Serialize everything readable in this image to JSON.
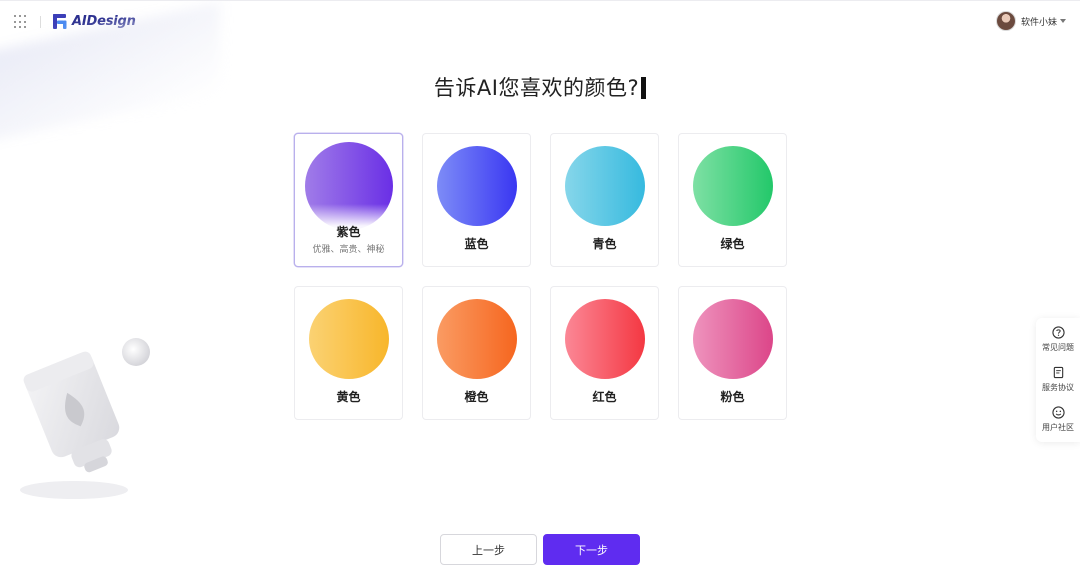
{
  "app": {
    "name": "AIDesign"
  },
  "user": {
    "name": "软件小妹"
  },
  "page": {
    "title": "告诉AI您喜欢的颜色?"
  },
  "colors": [
    {
      "label": "紫色",
      "desc": "优雅、高贵、神秘",
      "selected": true,
      "from": "#a07ce8",
      "to": "#6a2fe6"
    },
    {
      "label": "蓝色",
      "desc": "",
      "selected": false,
      "from": "#7d8cf7",
      "to": "#3a37f2"
    },
    {
      "label": "青色",
      "desc": "",
      "selected": false,
      "from": "#86d6ea",
      "to": "#36badf"
    },
    {
      "label": "绿色",
      "desc": "",
      "selected": false,
      "from": "#7ee0a4",
      "to": "#23c86a"
    },
    {
      "label": "黄色",
      "desc": "",
      "selected": false,
      "from": "#fbd273",
      "to": "#f8b62b"
    },
    {
      "label": "橙色",
      "desc": "",
      "selected": false,
      "from": "#fa9b63",
      "to": "#f6661f"
    },
    {
      "label": "红色",
      "desc": "",
      "selected": false,
      "from": "#fb8796",
      "to": "#f43842"
    },
    {
      "label": "粉色",
      "desc": "",
      "selected": false,
      "from": "#ee93bd",
      "to": "#dc4689"
    }
  ],
  "help": [
    {
      "label": "常见问题",
      "icon": "question-icon"
    },
    {
      "label": "服务协议",
      "icon": "document-icon"
    },
    {
      "label": "用户社区",
      "icon": "smile-icon"
    }
  ],
  "buttons": {
    "prev": "上一步",
    "next": "下一步"
  },
  "theme": {
    "accent": "#5f2cf0"
  }
}
